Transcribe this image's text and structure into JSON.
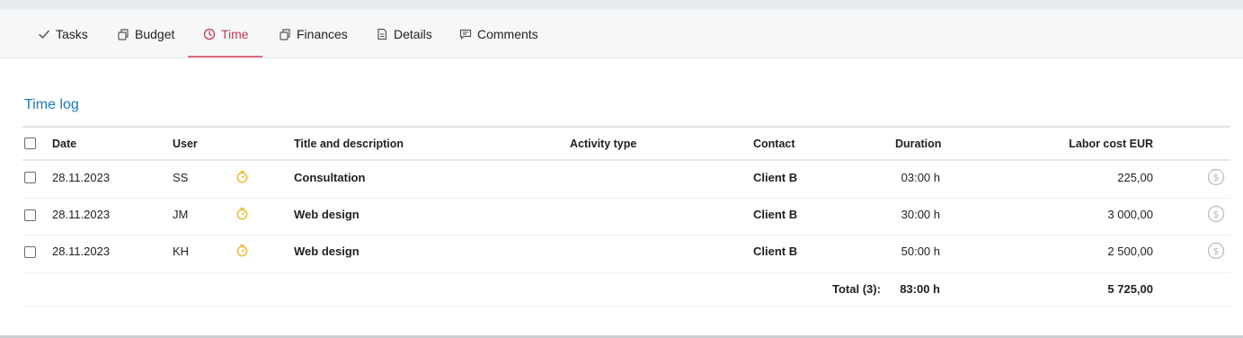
{
  "tabs": [
    {
      "label": "Tasks",
      "icon": "check-icon"
    },
    {
      "label": "Budget",
      "icon": "budget-icon"
    },
    {
      "label": "Time",
      "icon": "clock-icon",
      "active": true
    },
    {
      "label": "Finances",
      "icon": "finances-icon"
    },
    {
      "label": "Details",
      "icon": "document-icon"
    },
    {
      "label": "Comments",
      "icon": "comment-icon"
    }
  ],
  "active_color": "#c53a53",
  "section": {
    "title": "Time log"
  },
  "table": {
    "headers": {
      "date": "Date",
      "user": "User",
      "title": "Title and description",
      "activity": "Activity type",
      "contact": "Contact",
      "duration": "Duration",
      "cost": "Labor cost EUR"
    },
    "rows": [
      {
        "date": "28.11.2023",
        "user": "SS",
        "title": "Consultation",
        "activity": "",
        "contact": "Client B",
        "duration": "03:00 h",
        "cost": "225,00"
      },
      {
        "date": "28.11.2023",
        "user": "JM",
        "title": "Web design",
        "activity": "",
        "contact": "Client B",
        "duration": "30:00 h",
        "cost": "3 000,00"
      },
      {
        "date": "28.11.2023",
        "user": "KH",
        "title": "Web design",
        "activity": "",
        "contact": "Client B",
        "duration": "50:00 h",
        "cost": "2 500,00"
      }
    ],
    "total": {
      "label": "Total (3):",
      "duration": "83:00 h",
      "cost": "5 725,00"
    }
  }
}
